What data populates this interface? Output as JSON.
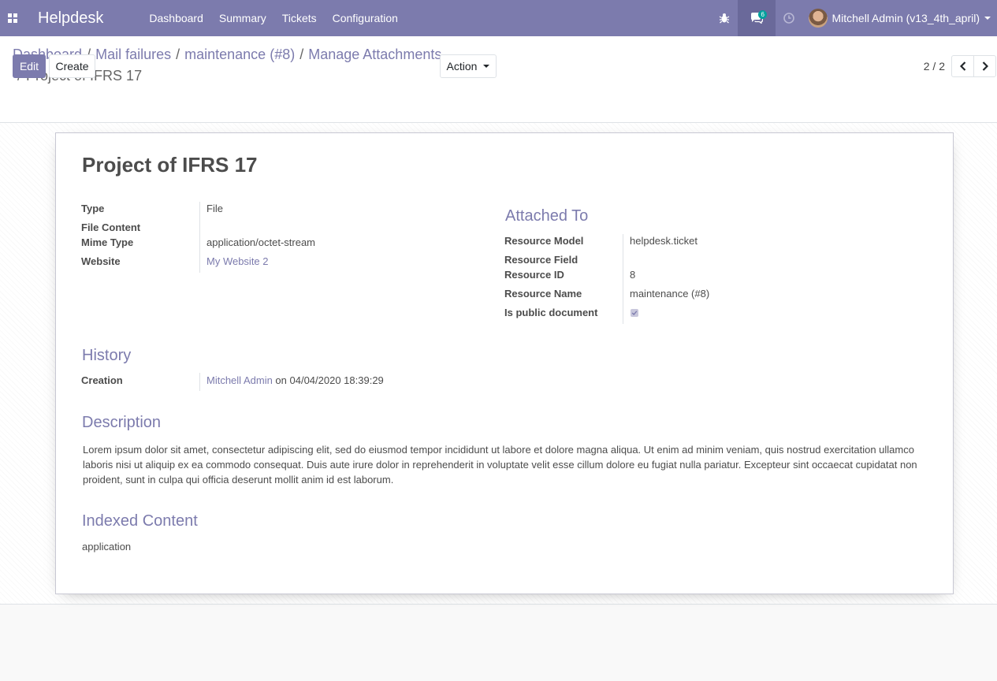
{
  "navbar": {
    "brand": "Helpdesk",
    "menu": [
      "Dashboard",
      "Summary",
      "Tickets",
      "Configuration"
    ],
    "messages_badge": "6",
    "user_name": "Mitchell Admin (v13_4th_april)",
    "icons": [
      "apps-icon",
      "bug-icon",
      "chat-icon",
      "clock-icon"
    ]
  },
  "breadcrumb": {
    "items": [
      "Dashboard",
      "Mail failures",
      "maintenance (#8)",
      "Manage Attachments"
    ],
    "current": "Project of IFRS 17"
  },
  "toolbar": {
    "edit_label": "Edit",
    "create_label": "Create",
    "action_label": "Action",
    "pager": "2 / 2"
  },
  "record": {
    "title": "Project of IFRS 17",
    "fields": {
      "type_label": "Type",
      "type_value": "File",
      "file_content_label": "File Content",
      "mime_label": "Mime Type",
      "mime_value": "application/octet-stream",
      "website_label": "Website",
      "website_value": "My Website 2"
    },
    "attached_to": {
      "heading": "Attached To",
      "res_model_label": "Resource Model",
      "res_model_value": "helpdesk.ticket",
      "res_field_label": "Resource Field",
      "res_id_label": "Resource ID",
      "res_id_value": "8",
      "res_name_label": "Resource Name",
      "res_name_value": "maintenance (#8)",
      "public_label": "Is public document",
      "public_value": true
    },
    "history": {
      "heading": "History",
      "creation_label": "Creation",
      "creation_user": "Mitchell Admin",
      "creation_rest": " on 04/04/2020 18:39:29"
    },
    "description": {
      "heading": "Description",
      "text": "Lorem ipsum dolor sit amet, consectetur adipiscing elit, sed do eiusmod tempor incididunt ut labore et dolore magna aliqua. Ut enim ad minim veniam, quis nostrud exercitation ullamco laboris nisi ut aliquip ex ea commodo consequat. Duis aute irure dolor in reprehenderit in voluptate velit esse cillum dolore eu fugiat nulla pariatur. Excepteur sint occaecat cupidatat non proident, sunt in culpa qui officia deserunt mollit anim id est laborum."
    },
    "indexed": {
      "heading": "Indexed Content",
      "text": "application"
    }
  }
}
